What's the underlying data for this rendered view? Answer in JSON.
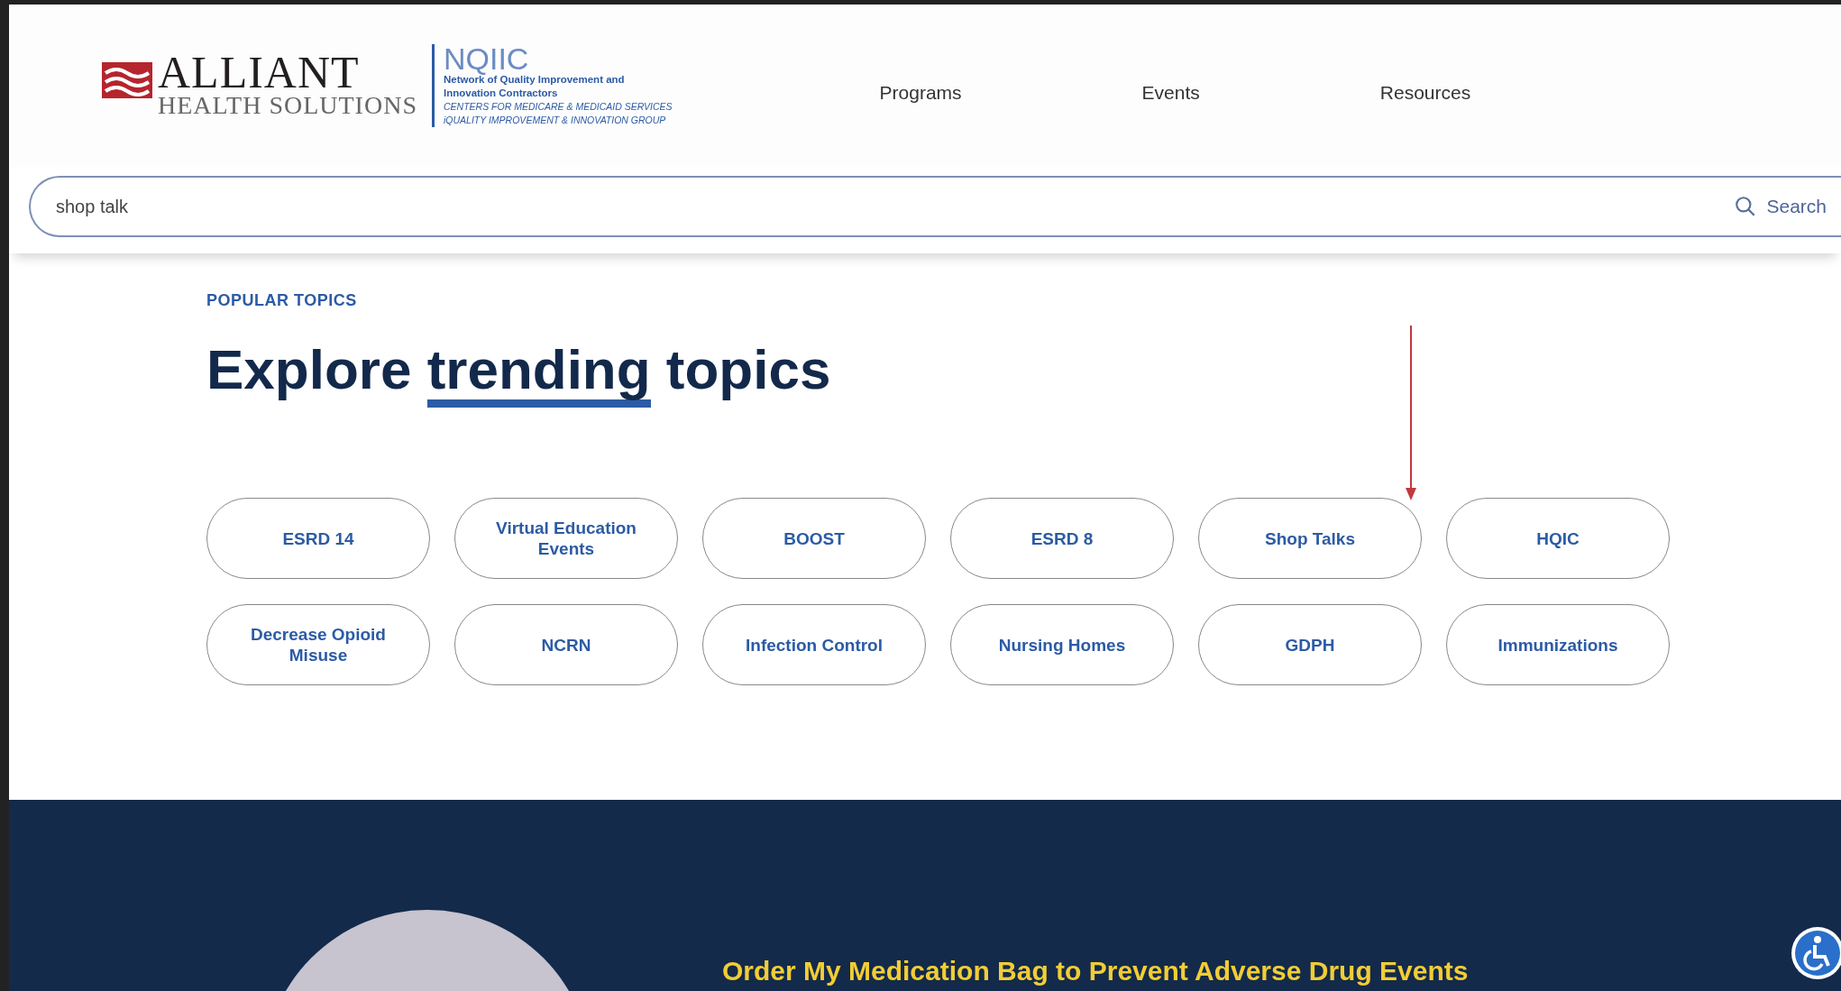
{
  "logo": {
    "brand_top": "ALLIANT",
    "brand_bottom": "HEALTH SOLUTIONS",
    "program": "NQIIC",
    "program_line_1": "Network of Quality Improvement and",
    "program_line_2": "Innovation Contractors",
    "agency_line_1": "CENTERS FOR MEDICARE & MEDICAID SERVICES",
    "agency_line_2": "iQUALITY IMPROVEMENT & INNOVATION GROUP"
  },
  "nav": [
    "Programs",
    "Events",
    "Resources"
  ],
  "search": {
    "value": "shop talk",
    "button": "Search"
  },
  "topics_section": {
    "eyebrow": "POPULAR TOPICS",
    "heading_before": "Explore",
    "heading_highlight": "trending",
    "heading_after": "topics",
    "topics": [
      {
        "label": "ESRD 14"
      },
      {
        "label": "Virtual Education Events"
      },
      {
        "label": "BOOST"
      },
      {
        "label": "ESRD 8"
      },
      {
        "label": "Shop Talks"
      },
      {
        "label": "HQIC"
      },
      {
        "label": "Decrease Opioid Misuse"
      },
      {
        "label": "NCRN"
      },
      {
        "label": "Infection Control"
      },
      {
        "label": "Nursing Homes"
      },
      {
        "label": "GDPH"
      },
      {
        "label": "Immunizations"
      }
    ]
  },
  "feature": {
    "title": "Order My Medication Bag to Prevent Adverse Drug Events"
  }
}
